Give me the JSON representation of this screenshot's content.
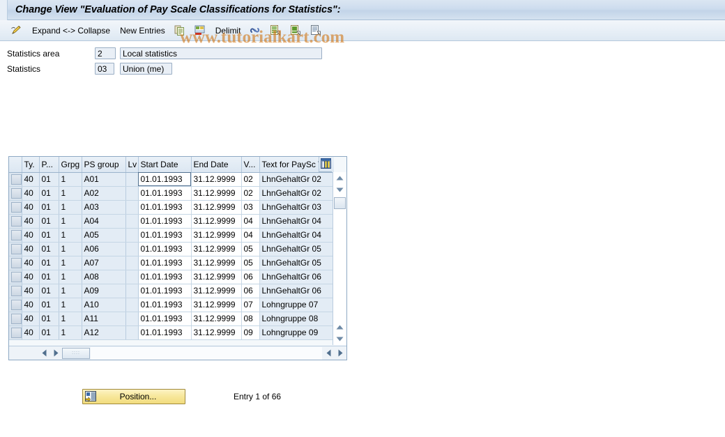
{
  "window": {
    "title": "Change View \"Evaluation of Pay Scale Classifications for Statistics\":"
  },
  "watermark": {
    "text": "www.tutorialkart.com",
    "color": "#d07818"
  },
  "toolbar": {
    "items": [
      {
        "name": "edit-pencil",
        "icon": "pencil-icon",
        "label": ""
      },
      {
        "name": "expand-collapse",
        "icon": "",
        "label": "Expand <-> Collapse"
      },
      {
        "name": "new-entries",
        "icon": "",
        "label": "New Entries"
      },
      {
        "name": "copy",
        "icon": "copy-icon",
        "label": ""
      },
      {
        "name": "undo",
        "icon": "undo-icon",
        "label": ""
      },
      {
        "name": "delimit",
        "icon": "",
        "label": "Delimit"
      },
      {
        "name": "select-all",
        "icon": "link-icon",
        "label": ""
      },
      {
        "name": "select-block",
        "icon": "page-green-icon",
        "label": ""
      },
      {
        "name": "deselect",
        "icon": "page-green2-icon",
        "label": ""
      },
      {
        "name": "details",
        "icon": "page-lines-icon",
        "label": ""
      }
    ]
  },
  "form": {
    "rows": [
      {
        "label": "Statistics area",
        "key": "2",
        "desc": "Local statistics"
      },
      {
        "label": "Statistics",
        "key": "03",
        "desc": "Union (me)"
      }
    ]
  },
  "table": {
    "columns": [
      {
        "key": "ty",
        "label": "Ty."
      },
      {
        "key": "p",
        "label": "P..."
      },
      {
        "key": "grpg",
        "label": "Grpg"
      },
      {
        "key": "ps",
        "label": "PS group"
      },
      {
        "key": "lv",
        "label": "Lv"
      },
      {
        "key": "sd",
        "label": "Start Date"
      },
      {
        "key": "ed",
        "label": "End Date"
      },
      {
        "key": "v",
        "label": "V..."
      },
      {
        "key": "txt",
        "label": "Text for PaySc Val"
      }
    ],
    "column_config_icon": "table-columns-icon",
    "rows": [
      {
        "ty": "40",
        "p": "01",
        "grpg": "1",
        "ps": "A01",
        "lv": "",
        "sd": "01.01.1993",
        "ed": "31.12.9999",
        "v": "02",
        "txt": "LhnGehaltGr 02",
        "selected": true
      },
      {
        "ty": "40",
        "p": "01",
        "grpg": "1",
        "ps": "A02",
        "lv": "",
        "sd": "01.01.1993",
        "ed": "31.12.9999",
        "v": "02",
        "txt": "LhnGehaltGr 02",
        "selected": false
      },
      {
        "ty": "40",
        "p": "01",
        "grpg": "1",
        "ps": "A03",
        "lv": "",
        "sd": "01.01.1993",
        "ed": "31.12.9999",
        "v": "03",
        "txt": "LhnGehaltGr 03",
        "selected": false
      },
      {
        "ty": "40",
        "p": "01",
        "grpg": "1",
        "ps": "A04",
        "lv": "",
        "sd": "01.01.1993",
        "ed": "31.12.9999",
        "v": "04",
        "txt": "LhnGehaltGr 04",
        "selected": false
      },
      {
        "ty": "40",
        "p": "01",
        "grpg": "1",
        "ps": "A05",
        "lv": "",
        "sd": "01.01.1993",
        "ed": "31.12.9999",
        "v": "04",
        "txt": "LhnGehaltGr 04",
        "selected": false
      },
      {
        "ty": "40",
        "p": "01",
        "grpg": "1",
        "ps": "A06",
        "lv": "",
        "sd": "01.01.1993",
        "ed": "31.12.9999",
        "v": "05",
        "txt": "LhnGehaltGr 05",
        "selected": false
      },
      {
        "ty": "40",
        "p": "01",
        "grpg": "1",
        "ps": "A07",
        "lv": "",
        "sd": "01.01.1993",
        "ed": "31.12.9999",
        "v": "05",
        "txt": "LhnGehaltGr 05",
        "selected": false
      },
      {
        "ty": "40",
        "p": "01",
        "grpg": "1",
        "ps": "A08",
        "lv": "",
        "sd": "01.01.1993",
        "ed": "31.12.9999",
        "v": "06",
        "txt": "LhnGehaltGr 06",
        "selected": false
      },
      {
        "ty": "40",
        "p": "01",
        "grpg": "1",
        "ps": "A09",
        "lv": "",
        "sd": "01.01.1993",
        "ed": "31.12.9999",
        "v": "06",
        "txt": "LhnGehaltGr 06",
        "selected": false
      },
      {
        "ty": "40",
        "p": "01",
        "grpg": "1",
        "ps": "A10",
        "lv": "",
        "sd": "01.01.1993",
        "ed": "31.12.9999",
        "v": "07",
        "txt": "Lohngruppe  07",
        "selected": false
      },
      {
        "ty": "40",
        "p": "01",
        "grpg": "1",
        "ps": "A11",
        "lv": "",
        "sd": "01.01.1993",
        "ed": "31.12.9999",
        "v": "08",
        "txt": "Lohngruppe  08",
        "selected": false
      },
      {
        "ty": "40",
        "p": "01",
        "grpg": "1",
        "ps": "A12",
        "lv": "",
        "sd": "01.01.1993",
        "ed": "31.12.9999",
        "v": "09",
        "txt": "Lohngruppe  09",
        "selected": false
      }
    ],
    "scroll_thumb_label": "::::"
  },
  "footer": {
    "position_button_label": "Position...",
    "position_button_icon": "position-icon",
    "entry_status": "Entry 1 of 66"
  }
}
